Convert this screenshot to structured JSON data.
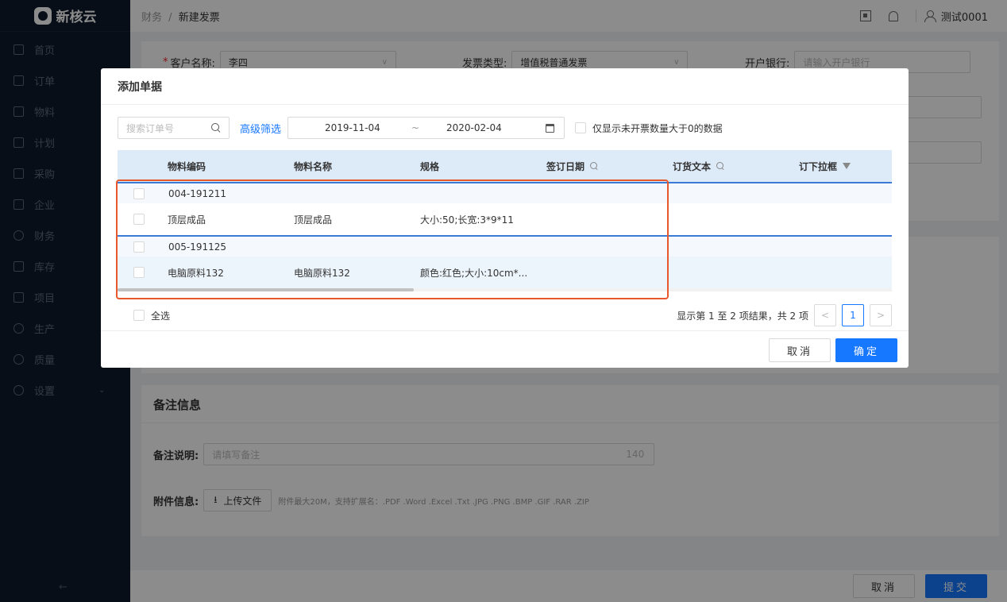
{
  "app": {
    "name": "新核云"
  },
  "sidebar": {
    "items": [
      {
        "label": "首页",
        "icon": "home-icon"
      },
      {
        "label": "订单",
        "icon": "order-icon"
      },
      {
        "label": "物料",
        "icon": "material-icon"
      },
      {
        "label": "计划",
        "icon": "plan-icon"
      },
      {
        "label": "采购",
        "icon": "purchase-icon"
      },
      {
        "label": "企业",
        "icon": "enterprise-icon"
      },
      {
        "label": "财务",
        "icon": "finance-icon"
      },
      {
        "label": "库存",
        "icon": "inventory-icon"
      },
      {
        "label": "项目",
        "icon": "project-icon"
      },
      {
        "label": "生产",
        "icon": "production-icon"
      },
      {
        "label": "质量",
        "icon": "quality-icon"
      },
      {
        "label": "设置",
        "icon": "settings-icon"
      }
    ],
    "collapse_glyph": "←"
  },
  "topbar": {
    "breadcrumb_parent": "财务",
    "breadcrumb_sep": "/",
    "breadcrumb_current": "新建发票",
    "user_name": "测试0001"
  },
  "form": {
    "customer_label": "客户名称:",
    "customer_value": "李四",
    "invoice_type_label": "发票类型:",
    "invoice_type_value": "增值税普通发票",
    "bank_label": "开户银行:",
    "bank_placeholder": "请输入开户银行",
    "remark_section_title": "备注信息",
    "remark_label": "备注说明:",
    "remark_placeholder": "请填写备注",
    "remark_counter": "140",
    "attachment_label": "附件信息:",
    "upload_label": "上传文件",
    "upload_hint": "附件最大20M，支持扩展名：.PDF .Word .Excel .Txt .JPG .PNG .BMP .GIF .RAR .ZIP"
  },
  "footer": {
    "cancel": "取消",
    "submit": "提交"
  },
  "modal": {
    "title": "添加单据",
    "search_placeholder": "搜索订单号",
    "advanced_filter": "高级筛选",
    "date_start": "2019-11-04",
    "date_sep": "~",
    "date_end": "2020-02-04",
    "only_unbilled_label": "仅显示未开票数量大于0的数据",
    "columns": [
      "物料编码",
      "物料名称",
      "规格",
      "签订日期",
      "订货文本",
      "订下拉框"
    ],
    "groups": [
      {
        "order_no": "004-191211",
        "items": [
          {
            "code": "顶层成品",
            "name": "顶层成品",
            "spec": "大小:50;长宽:3*9*11"
          }
        ]
      },
      {
        "order_no": "005-191125",
        "items": [
          {
            "code": "电脑原料132",
            "name": "电脑原料132",
            "spec": "颜色:红色;大小:10cm*..."
          }
        ]
      }
    ],
    "select_all": "全选",
    "pagination_text": "显示第 1 至 2 项结果，共 2 项",
    "page_prev": "<",
    "page_current": "1",
    "page_next": ">",
    "cancel": "取消",
    "confirm": "确定"
  }
}
